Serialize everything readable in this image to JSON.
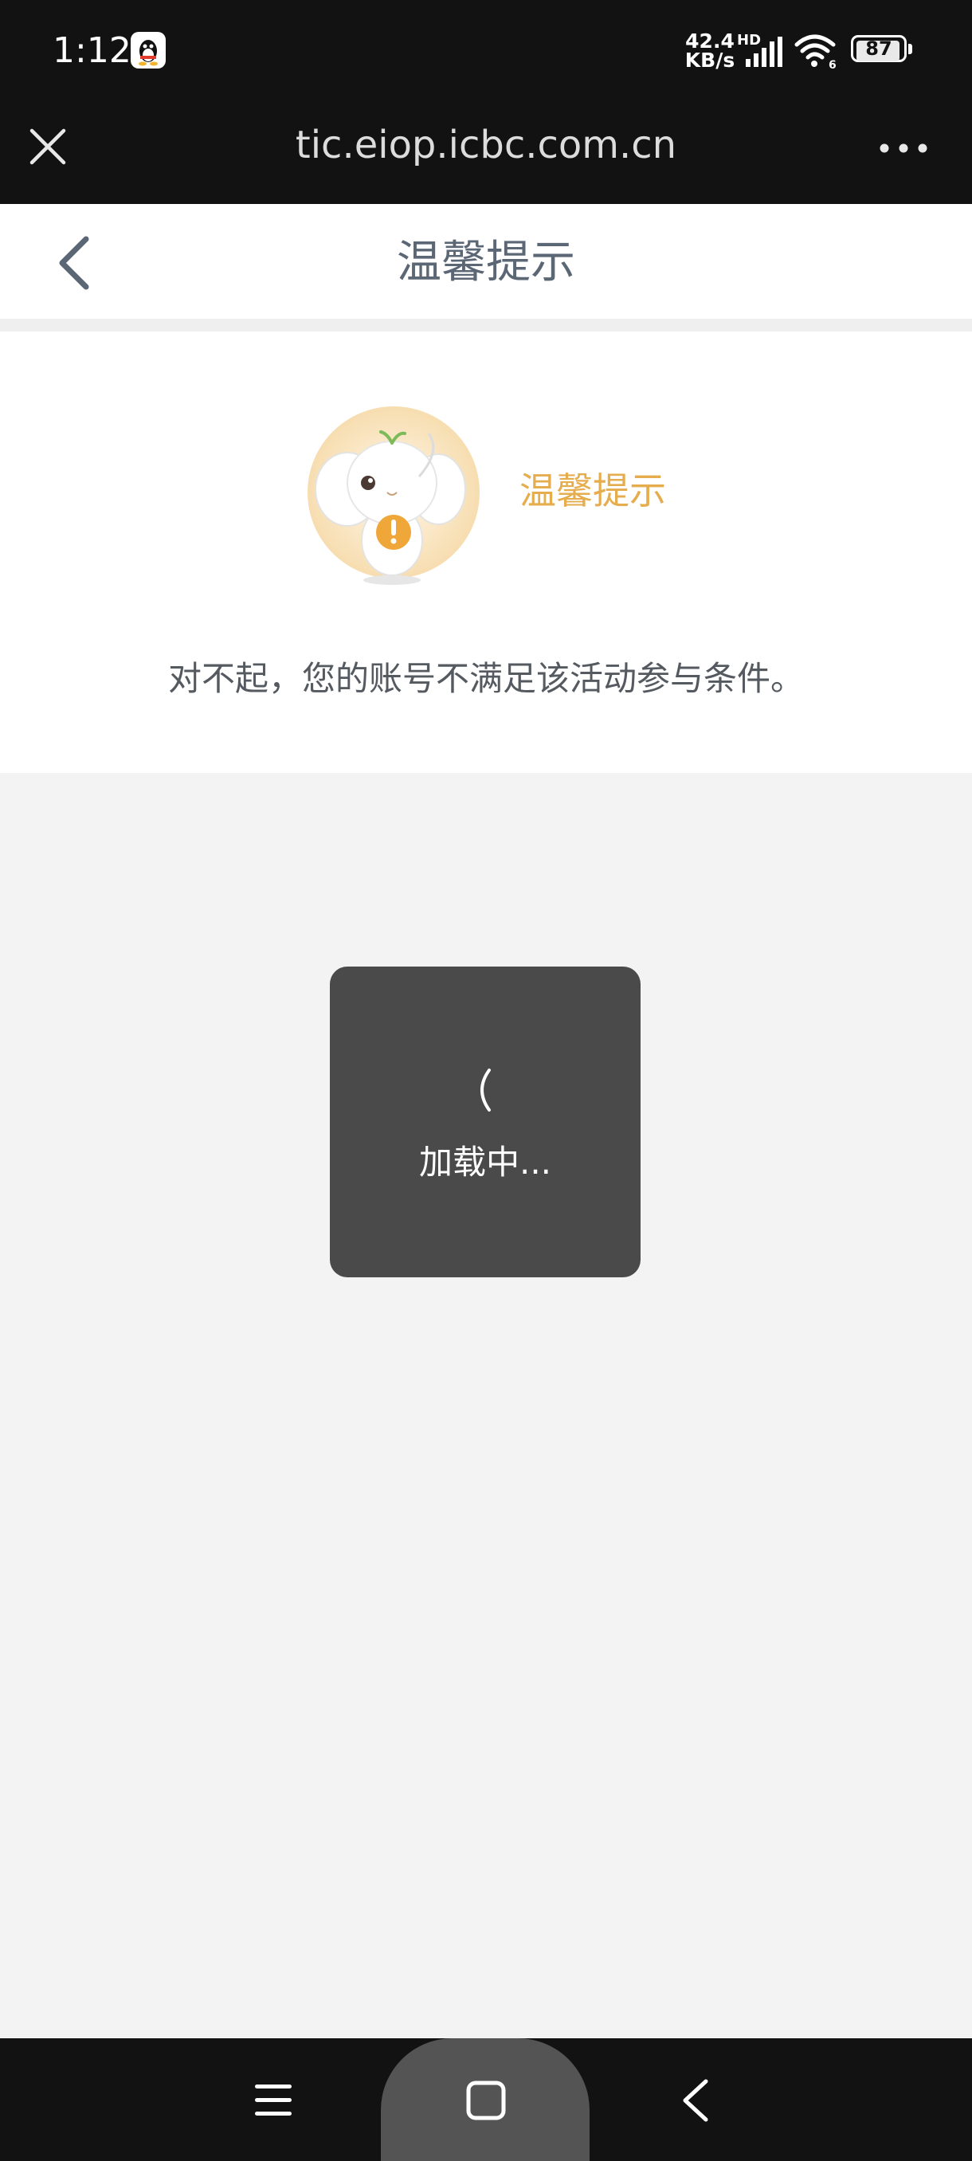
{
  "status_bar": {
    "time": "1:12",
    "net_speed_value": "42.4",
    "net_speed_unit": "KB/s",
    "network_type": "HD",
    "battery": "87",
    "icons": [
      "qq-penguin-icon",
      "signal-icon",
      "wifi-icon",
      "battery-icon"
    ]
  },
  "browser_bar": {
    "url": "tic.eiop.icbc.com.cn",
    "icons": [
      "close-icon",
      "more-icon"
    ]
  },
  "header": {
    "title": "温馨提示",
    "icons": [
      "back-chevron-icon"
    ]
  },
  "notice": {
    "title": "温馨提示",
    "message": "对不起，您的账号不满足该活动参与条件。",
    "accent_color": "#e6ad4f"
  },
  "loading": {
    "text": "加载中..."
  },
  "nav_bar": {
    "icons": [
      "menu-icon",
      "home-icon",
      "back-icon"
    ]
  }
}
